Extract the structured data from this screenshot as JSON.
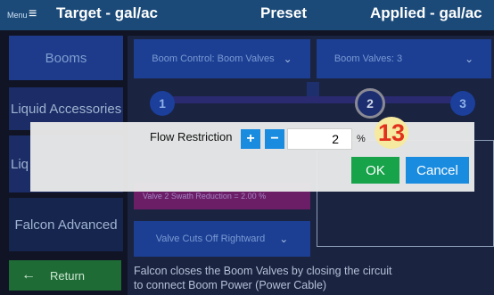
{
  "header": {
    "menu_label": "Menu",
    "menu_icon": "hamburger-icon",
    "target_title": "Target - gal/ac",
    "preset_title": "Preset",
    "applied_title": "Applied - gal/ac"
  },
  "sidebar": {
    "items": [
      {
        "label": "Booms"
      },
      {
        "label": "Liquid Accessories"
      },
      {
        "label": "Liq"
      },
      {
        "label": "Falcon Advanced"
      }
    ],
    "return_icon": "arrow-left-icon",
    "return_label": "Return"
  },
  "main": {
    "boom_control": "Boom Control: Boom Valves",
    "boom_valves": "Boom Valves: 3",
    "steps": [
      "1",
      "2",
      "3"
    ],
    "swath_reduction_text": "Valve 2 Swath Reduction = 2.00 %",
    "valve_cuts": "Valve Cuts Off Rightward",
    "description": "Falcon closes the Boom Valves by closing the circuit to connect Boom Power (Power Cable)"
  },
  "modal": {
    "label": "Flow Restriction",
    "plus_label": "+",
    "minus_label": "−",
    "value": "2",
    "unit": "%",
    "badge": "13",
    "ok_label": "OK",
    "cancel_label": "Cancel"
  },
  "colors": {
    "header": "#1b4a78",
    "ok": "#16a34a",
    "accent_blue": "#1a8ce0",
    "badge_text": "#e2311c",
    "badge_bg": "#f6eaa0"
  }
}
